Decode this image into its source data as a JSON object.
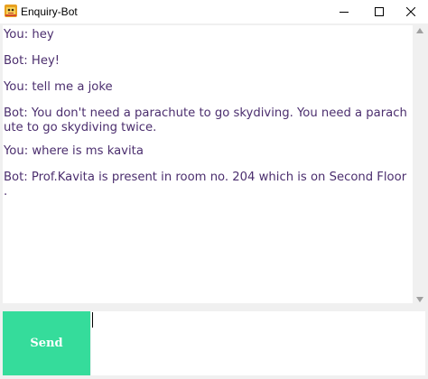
{
  "window": {
    "title": "Enquiry-Bot",
    "app_icon": "bot-app-icon",
    "controls": [
      "minimize-icon",
      "maximize-icon",
      "close-icon"
    ]
  },
  "chat": {
    "text_color": "#4b2e6e",
    "lines": [
      "You: hey",
      "Bot: Hey!",
      "You: tell me a joke",
      "Bot: You don't need a parachute to go skydiving. You need a parach",
      "ute to go skydiving twice.",
      "You: where is ms kavita",
      "Bot: Prof.Kavita is present in room no. 204 which is on Second Floor",
      "."
    ]
  },
  "send_button": {
    "label": "Send",
    "background": "#35dc9b",
    "text_color": "#ffffff"
  },
  "input": {
    "value": ""
  }
}
